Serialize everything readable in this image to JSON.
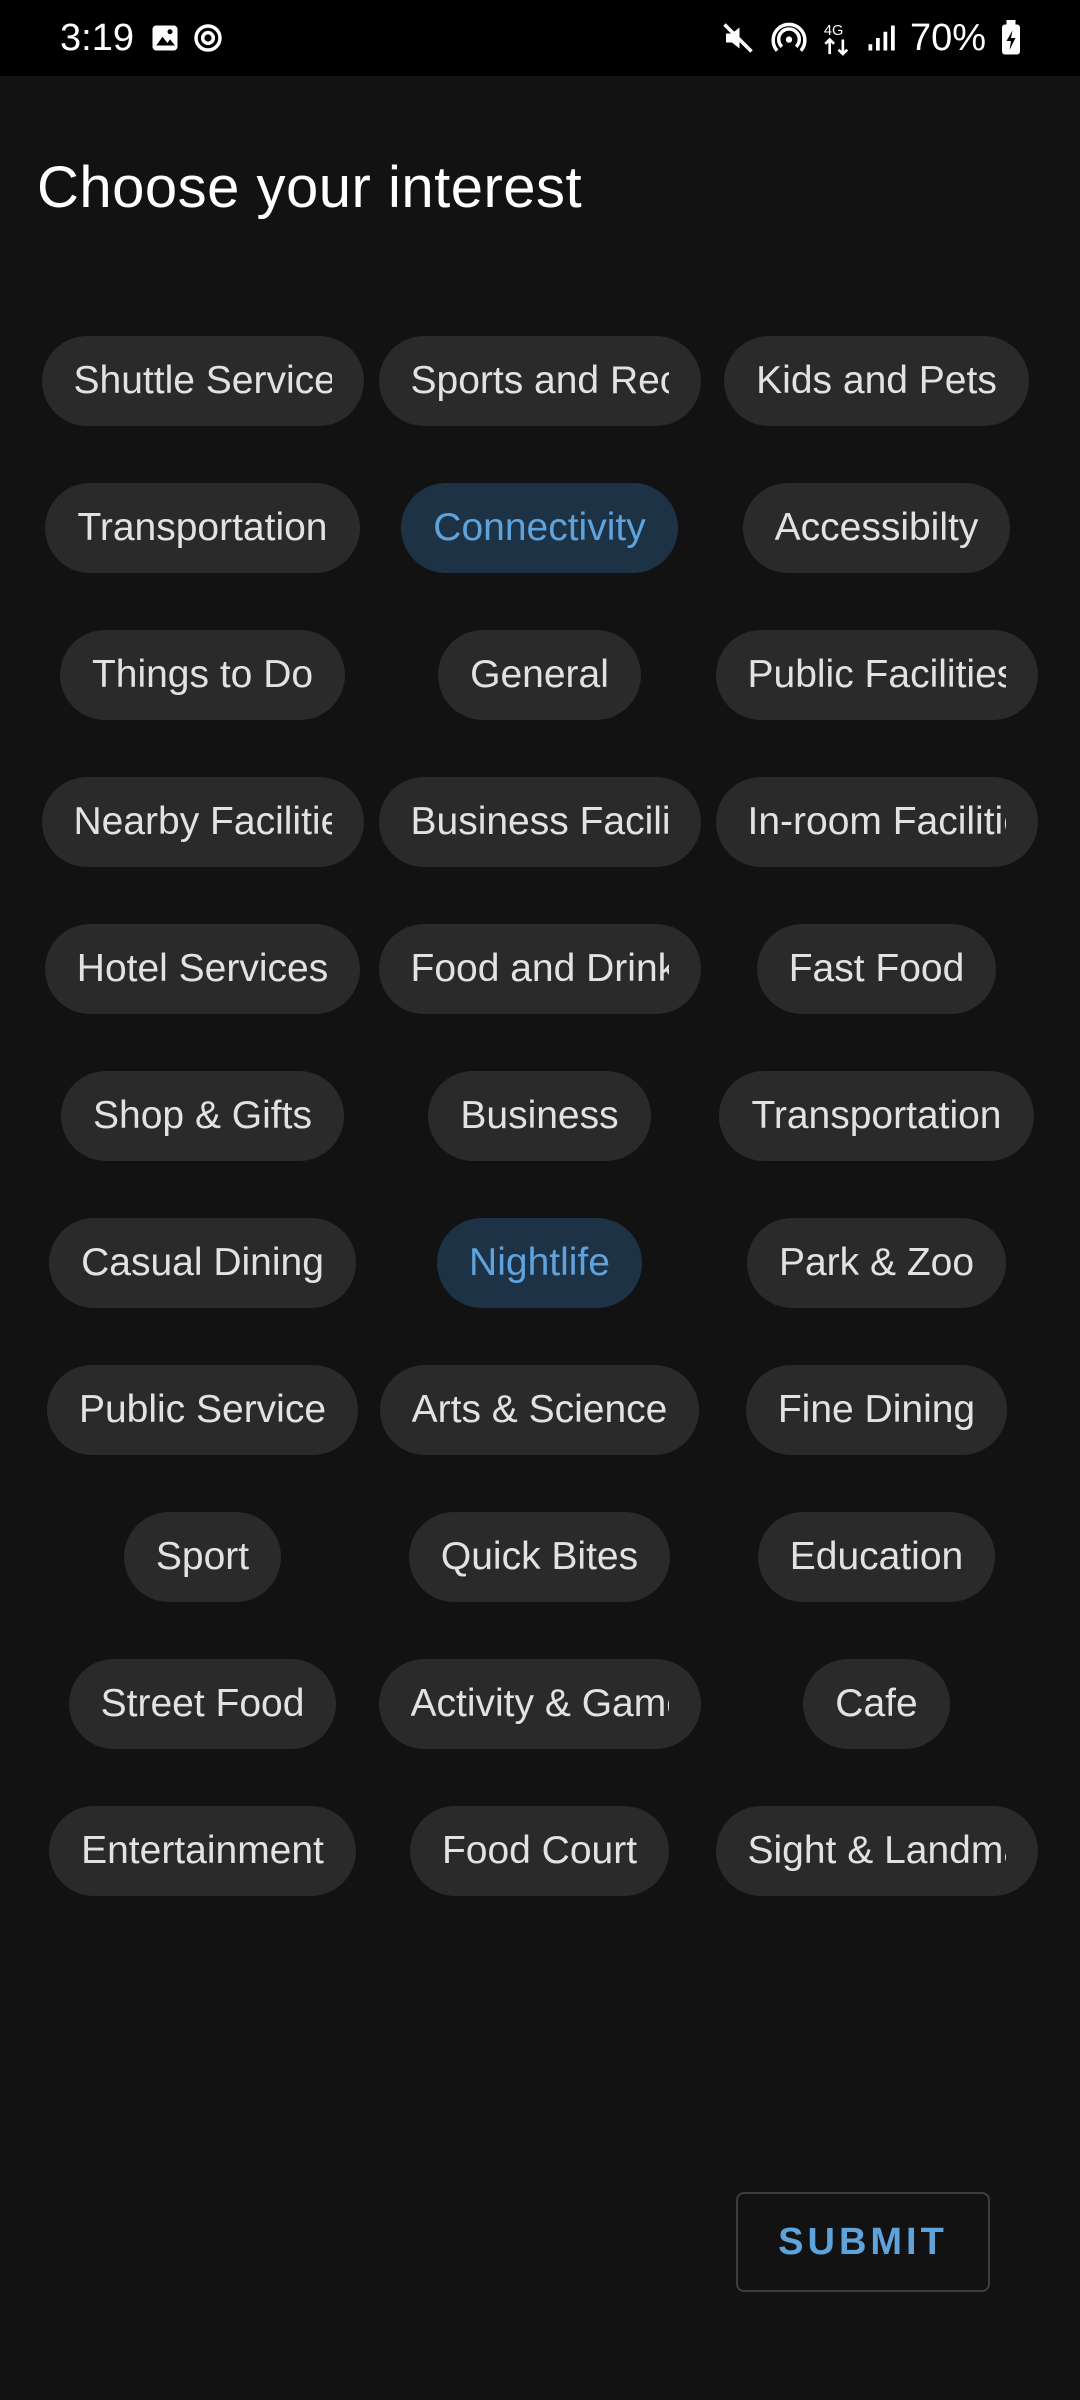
{
  "status_bar": {
    "time": "3:19",
    "battery": "70%",
    "left_icons": [
      "image-icon",
      "sync-icon"
    ],
    "right_icons": [
      "mute-icon",
      "hotspot-icon",
      "4g-icon",
      "signal-icon",
      "battery-icon"
    ]
  },
  "title": "Choose your interest",
  "accent_color": "#5fa3dc",
  "chips": [
    {
      "label": "Shuttle Service",
      "selected": false
    },
    {
      "label": "Sports and Recreation",
      "selected": false
    },
    {
      "label": "Kids and Pets",
      "selected": false
    },
    {
      "label": "Transportation",
      "selected": false
    },
    {
      "label": "Connectivity",
      "selected": true
    },
    {
      "label": "Accessibilty",
      "selected": false
    },
    {
      "label": "Things to Do",
      "selected": false
    },
    {
      "label": "General",
      "selected": false
    },
    {
      "label": "Public Facilities",
      "selected": false
    },
    {
      "label": "Nearby Facilities",
      "selected": false
    },
    {
      "label": "Business Facilities",
      "selected": false
    },
    {
      "label": "In-room Facilities",
      "selected": false
    },
    {
      "label": "Hotel Services",
      "selected": false
    },
    {
      "label": "Food and Drink",
      "selected": false
    },
    {
      "label": "Fast Food",
      "selected": false
    },
    {
      "label": "Shop & Gifts",
      "selected": false
    },
    {
      "label": "Business",
      "selected": false
    },
    {
      "label": "Transportation",
      "selected": false
    },
    {
      "label": "Casual Dining",
      "selected": false
    },
    {
      "label": "Nightlife",
      "selected": true
    },
    {
      "label": "Park & Zoo",
      "selected": false
    },
    {
      "label": "Public Service",
      "selected": false
    },
    {
      "label": "Arts & Science",
      "selected": false
    },
    {
      "label": "Fine Dining",
      "selected": false
    },
    {
      "label": "Sport",
      "selected": false
    },
    {
      "label": "Quick Bites",
      "selected": false
    },
    {
      "label": "Education",
      "selected": false
    },
    {
      "label": "Street Food",
      "selected": false
    },
    {
      "label": "Activity & Games",
      "selected": false
    },
    {
      "label": "Cafe",
      "selected": false
    },
    {
      "label": "Entertainment",
      "selected": false
    },
    {
      "label": "Food Court",
      "selected": false
    },
    {
      "label": "Sight & Landmark",
      "selected": false
    }
  ],
  "submit_label": "SUBMIT"
}
